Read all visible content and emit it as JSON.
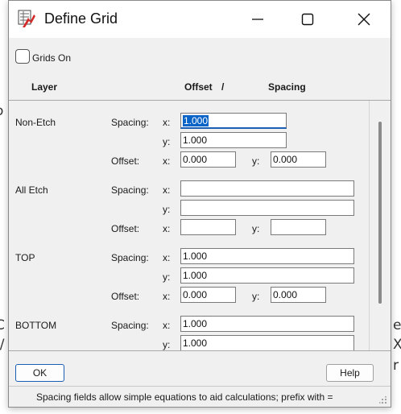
{
  "window": {
    "title": "Define Grid",
    "icon": "grid-app-icon",
    "controls": [
      "minimize-icon",
      "maximize-icon",
      "close-icon"
    ]
  },
  "grids_on": {
    "label": "Grids On",
    "checked": false
  },
  "headers": {
    "layer": "Layer",
    "offset": "Offset",
    "slash": "/",
    "spacing": "Spacing"
  },
  "labels": {
    "spacing": "Spacing:",
    "offset": "Offset:",
    "x": "x:",
    "y": "y:"
  },
  "layers": [
    {
      "name": "Non-Etch",
      "spacing_x": "1.000",
      "spacing_y": "1.000",
      "offset_x": "0.000",
      "offset_y": "0.000"
    },
    {
      "name": "All Etch",
      "spacing_x": "",
      "spacing_y": "",
      "offset_x": "",
      "offset_y": ""
    },
    {
      "name": "TOP",
      "spacing_x": "1.000",
      "spacing_y": "1.000",
      "offset_x": "0.000",
      "offset_y": "0.000"
    },
    {
      "name": "BOTTOM",
      "spacing_x": "1.000",
      "spacing_y": "1.000"
    }
  ],
  "buttons": {
    "ok": "OK",
    "help": "Help"
  },
  "status": "Spacing fields allow simple equations to aid calculations; prefix with =",
  "background_fragments": {
    "left": [
      "o",
      "C",
      "\\/"
    ],
    "right": [
      "e",
      "X",
      "r"
    ]
  },
  "colors": {
    "selection": "#0a64c8",
    "focus_underline": "#1a5fb4",
    "icon_red": "#d42a2a"
  }
}
